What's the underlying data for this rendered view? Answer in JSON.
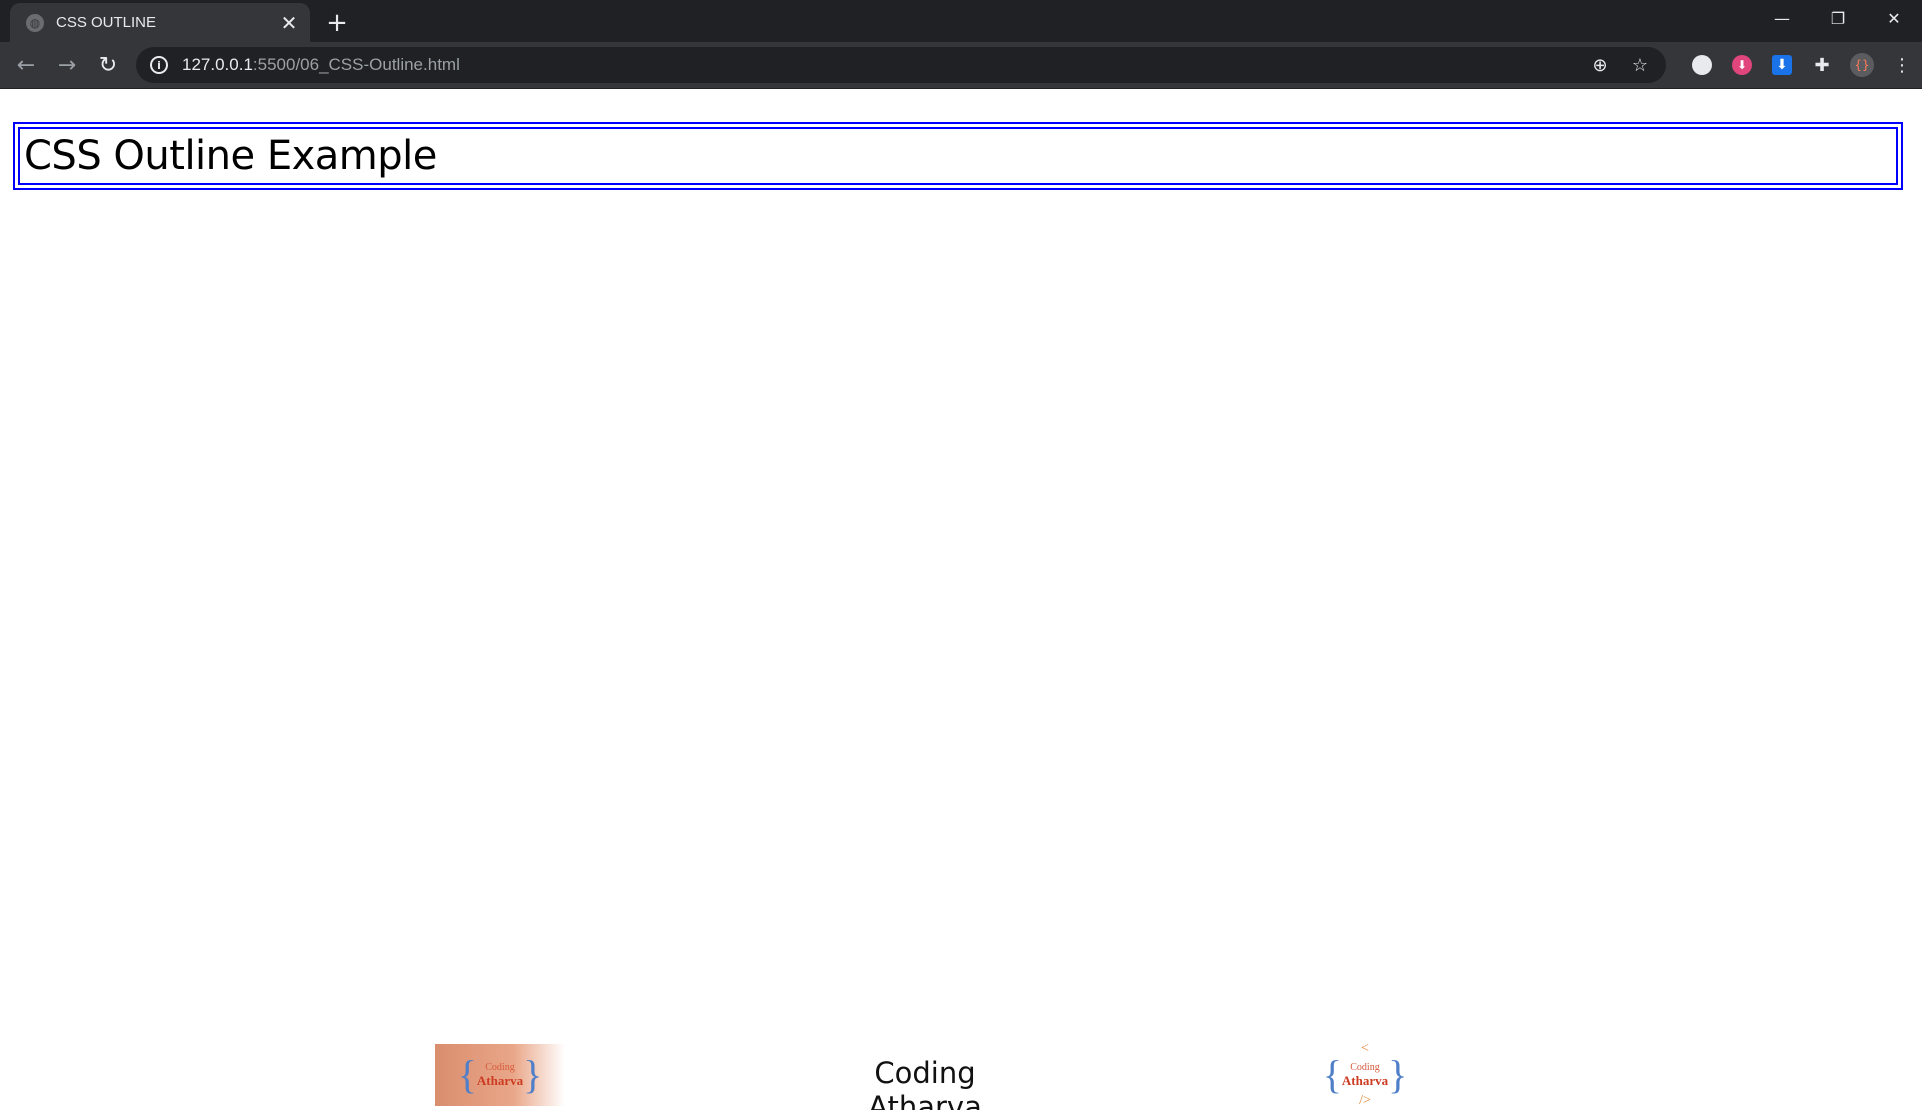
{
  "browser": {
    "tab_title": "CSS OUTLINE",
    "tab_close_glyph": "✕",
    "new_tab_glyph": "+",
    "url_host": "127.0.0.1",
    "url_path": ":5500/06_CSS-Outline.html",
    "window_controls": {
      "minimize": "—",
      "restore": "❐",
      "close": "✕"
    },
    "nav": {
      "back": "←",
      "forward": "→",
      "reload": "↻"
    },
    "icons": {
      "favicon": "globe-icon",
      "info": "info-icon",
      "zoom": "zoom-icon",
      "bookmark": "star-icon",
      "extensions": "puzzle-icon",
      "menu": "kebab-menu-icon"
    }
  },
  "page": {
    "heading": "CSS Outline Example",
    "outline_color": "#0000ff"
  },
  "footer": {
    "brand_name": "Coding Atharva",
    "logo_small": "Coding",
    "logo_bold": "Atharva",
    "logo_top": "<",
    "logo_bottom": "/>"
  }
}
